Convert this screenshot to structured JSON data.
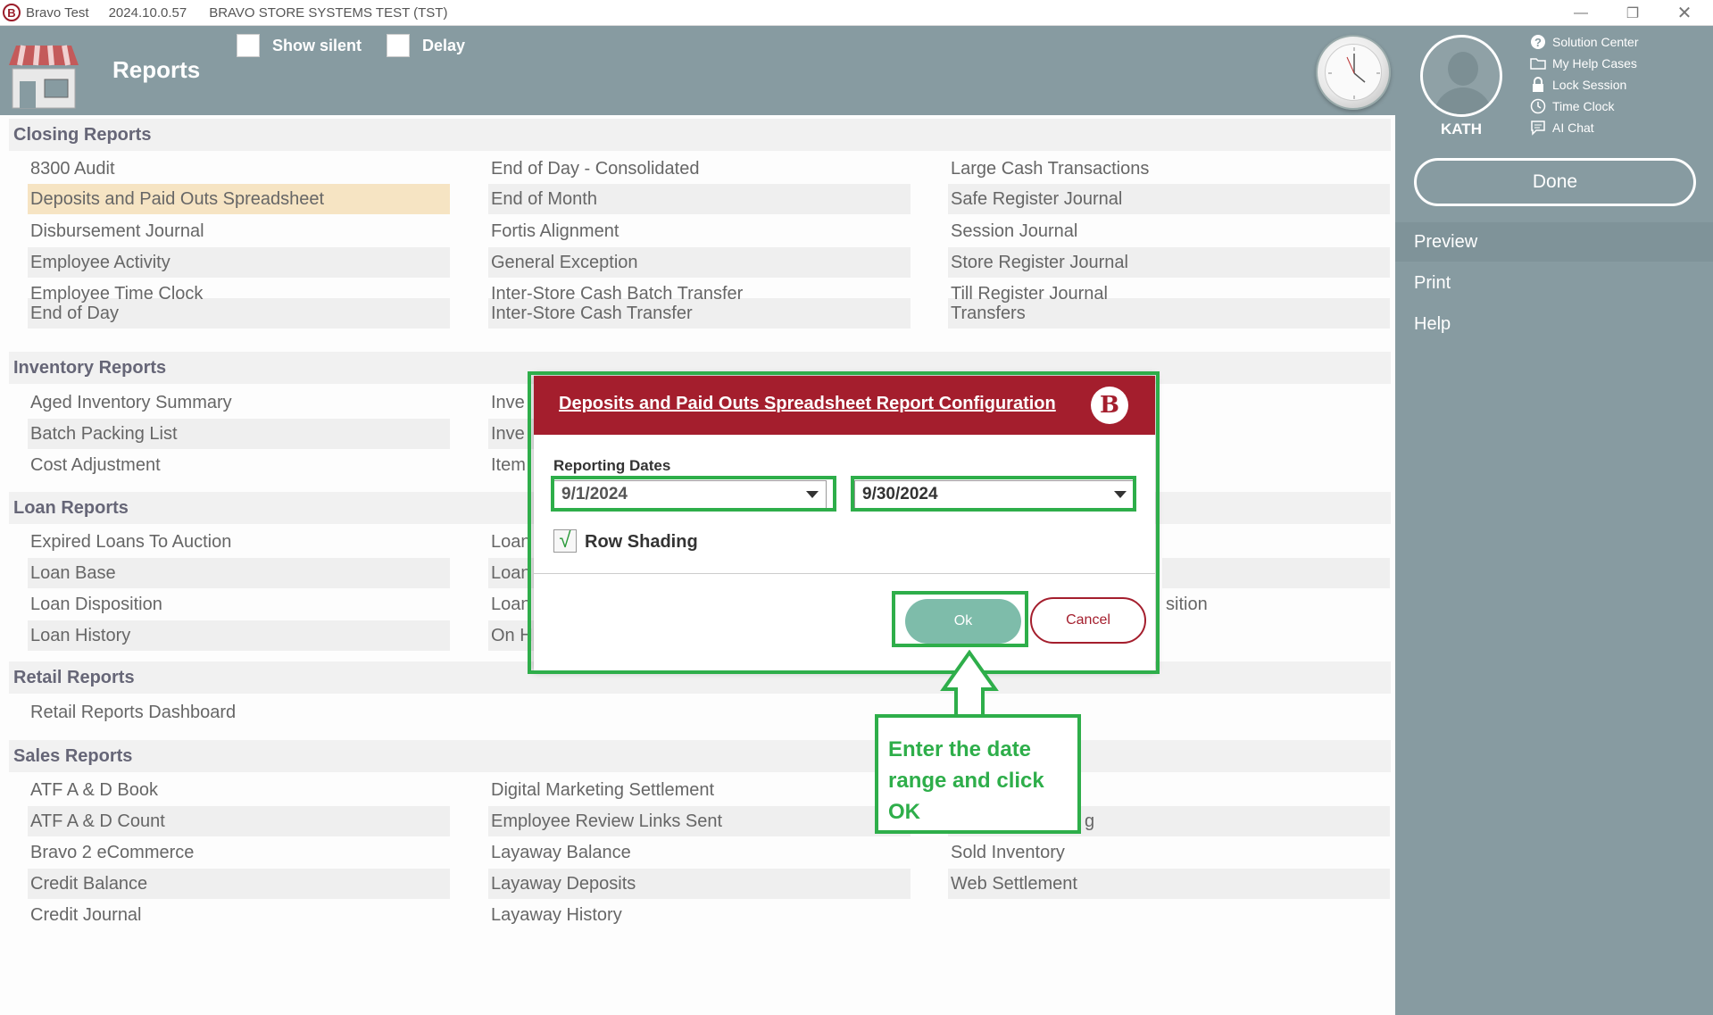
{
  "titlebar": {
    "app_name": "Bravo Test",
    "version": "2024.10.0.57",
    "system": "BRAVO STORE SYSTEMS TEST (TST)"
  },
  "header": {
    "title": "Reports",
    "show_silent_label": "Show silent",
    "delay_label": "Delay"
  },
  "user": {
    "name": "KATH"
  },
  "quick_links": [
    {
      "label": "Solution Center",
      "icon": "question-icon"
    },
    {
      "label": "My Help Cases",
      "icon": "folder-icon"
    },
    {
      "label": "Lock Session",
      "icon": "lock-icon"
    },
    {
      "label": "Time Clock",
      "icon": "clock-icon"
    },
    {
      "label": "AI Chat",
      "icon": "chat-icon"
    }
  ],
  "right_menu": {
    "done": "Done",
    "items": [
      "Preview",
      "Print",
      "Help"
    ]
  },
  "sections": {
    "closing": {
      "title": "Closing Reports",
      "col1": [
        "8300 Audit",
        "Deposits and Paid Outs Spreadsheet",
        "Disbursement Journal",
        "Employee Activity",
        "Employee Time Clock",
        "End of Day"
      ],
      "col2": [
        "End of Day - Consolidated",
        "End of Month",
        "Fortis Alignment",
        "General Exception",
        "Inter-Store Cash Batch Transfer",
        "Inter-Store Cash Transfer"
      ],
      "col3": [
        "Large Cash Transactions",
        "Safe Register Journal",
        "Session Journal",
        "Store Register Journal",
        "Till Register Journal",
        "Transfers"
      ]
    },
    "inventory": {
      "title": "Inventory Reports",
      "col1": [
        "Aged Inventory Summary",
        "Batch Packing List",
        "Cost Adjustment"
      ],
      "col2": [
        "Inve",
        "Inve",
        "Item"
      ]
    },
    "loan": {
      "title": "Loan Reports",
      "col1": [
        "Expired Loans To Auction",
        "Loan Base",
        "Loan Disposition",
        "Loan History"
      ],
      "col2": [
        "Loan",
        "Loan",
        "Loan",
        "On H"
      ],
      "col3_partial": "sition"
    },
    "retail": {
      "title": "Retail Reports",
      "col1": [
        "Retail Reports Dashboard"
      ]
    },
    "sales": {
      "title": "Sales Reports",
      "col1": [
        "ATF A & D Book",
        "ATF A & D Count",
        "Bravo 2 eCommerce",
        "Credit Balance",
        "Credit Journal"
      ],
      "col2": [
        "Digital Marketing Settlement",
        "Employee Review Links Sent",
        "Layaway Balance",
        "Layaway Deposits",
        "Layaway History"
      ],
      "col3": [
        "",
        "g",
        "Sold Inventory",
        "Web Settlement"
      ]
    }
  },
  "modal": {
    "title": "Deposits and Paid Outs Spreadsheet Report Configuration",
    "logo_letter": "B",
    "reporting_dates_label": "Reporting Dates",
    "start_date": "9/1/2024",
    "end_date": "9/30/2024",
    "row_shading_label": "Row Shading",
    "row_shading_checked": true,
    "check_glyph": "√",
    "ok": "Ok",
    "cancel": "Cancel"
  },
  "callout": {
    "text": "Enter the date range and click OK"
  },
  "colors": {
    "header": "#879ba1",
    "modal_header": "#a41e2d",
    "highlight": "#2eae4a",
    "selected_row": "#f6e4c3",
    "ok_button": "#7ebcaa"
  }
}
